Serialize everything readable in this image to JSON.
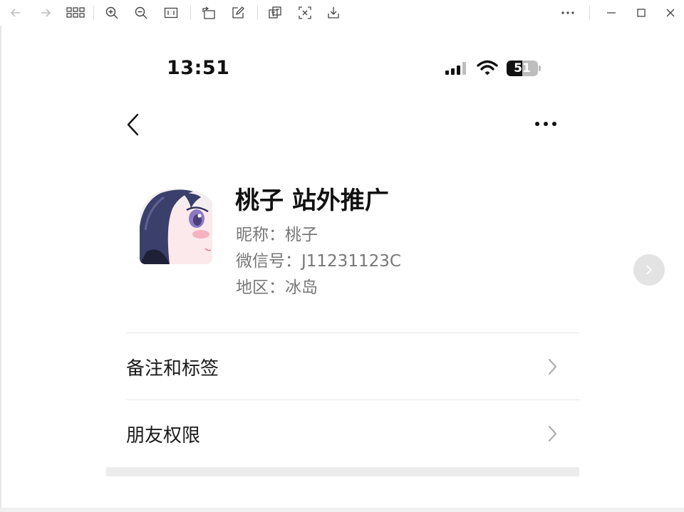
{
  "toolbar": {
    "icons": [
      "back-arrow-icon",
      "forward-arrow-icon",
      "grid-icon",
      "zoom-in-icon",
      "zoom-out-icon",
      "actual-size-icon",
      "rotate-icon",
      "edit-icon",
      "translate-icon",
      "crop-icon",
      "download-icon",
      "more-icon",
      "minimize-icon",
      "maximize-icon",
      "close-icon"
    ]
  },
  "status_bar": {
    "time": "13:51",
    "battery_level": "51",
    "battery_percent": 51
  },
  "profile": {
    "display_name": "桃子 站外推广",
    "nickname": "昵称：桃子",
    "wechat_id": "微信号：J11231123C",
    "region": "地区：冰岛"
  },
  "menu": {
    "items": [
      {
        "label": "备注和标签"
      },
      {
        "label": "朋友权限"
      }
    ]
  },
  "colors": {
    "primary_text": "#111111",
    "secondary_text": "#777777",
    "divider": "#e8e8e8"
  }
}
